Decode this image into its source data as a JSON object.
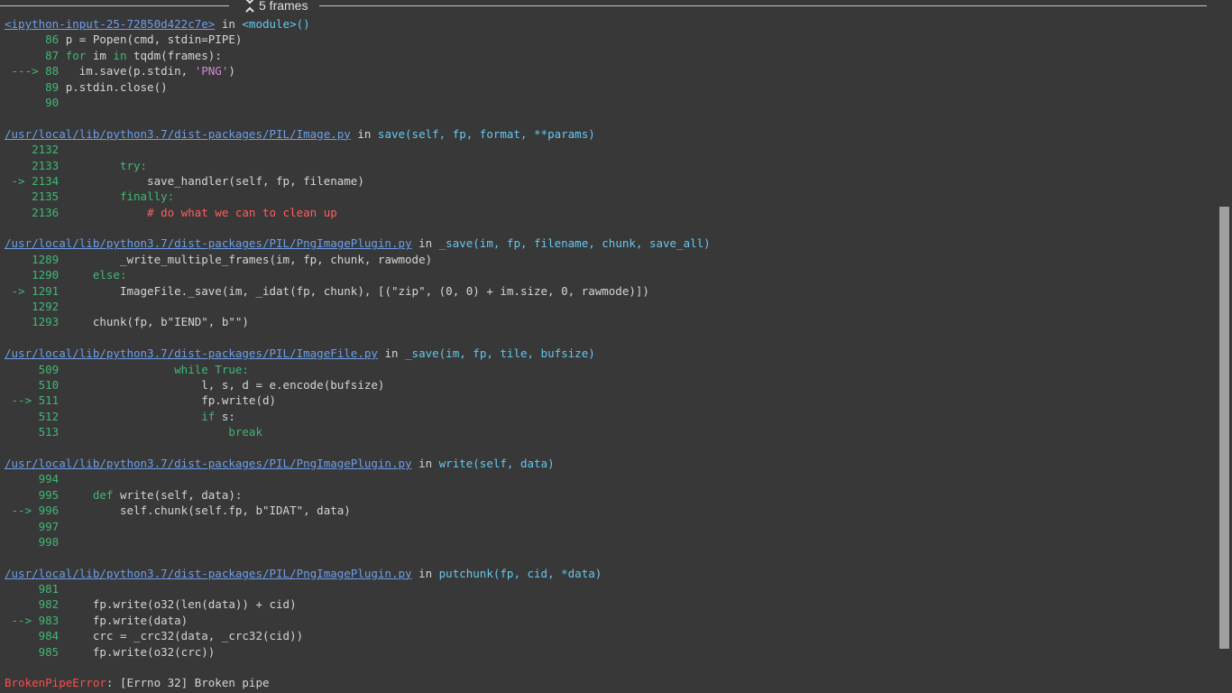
{
  "collapsed_frames": {
    "label": "5 frames"
  },
  "frames": [
    {
      "file": "<ipython-input-25-72850d422c7e>",
      "in_word": "in",
      "signature": "<module>()",
      "lines": [
        {
          "marker": "",
          "num": "86",
          "code": [
            {
              "t": "p = Popen(cmd, stdin=PIPE)",
              "c": "plain"
            }
          ]
        },
        {
          "marker": "",
          "num": "87",
          "code": [
            {
              "t": "for",
              "c": "kw"
            },
            {
              "t": " im ",
              "c": "plain"
            },
            {
              "t": "in",
              "c": "kw"
            },
            {
              "t": " tqdm(frames):",
              "c": "plain"
            }
          ]
        },
        {
          "marker": "--->",
          "num": "88",
          "code": [
            {
              "t": "  im.save(p.stdin, ",
              "c": "plain"
            },
            {
              "t": "'PNG'",
              "c": "str"
            },
            {
              "t": ")",
              "c": "plain"
            }
          ]
        },
        {
          "marker": "",
          "num": "89",
          "code": [
            {
              "t": "p.stdin.close()",
              "c": "plain"
            }
          ]
        },
        {
          "marker": "",
          "num": "90",
          "code": []
        }
      ]
    },
    {
      "file": "/usr/local/lib/python3.7/dist-packages/PIL/Image.py",
      "in_word": "in",
      "signature": "save(self, fp, format, **params)",
      "lines": [
        {
          "marker": "",
          "num": "2132",
          "code": []
        },
        {
          "marker": "",
          "num": "2133",
          "code": [
            {
              "t": "        try:",
              "c": "kw"
            }
          ]
        },
        {
          "marker": "->",
          "num": "2134",
          "code": [
            {
              "t": "            save_handler(self, fp, filename)",
              "c": "plain"
            }
          ]
        },
        {
          "marker": "",
          "num": "2135",
          "code": [
            {
              "t": "        finally:",
              "c": "kw"
            }
          ]
        },
        {
          "marker": "",
          "num": "2136",
          "code": [
            {
              "t": "            # do what we can to clean up",
              "c": "comment"
            }
          ]
        }
      ]
    },
    {
      "file": "/usr/local/lib/python3.7/dist-packages/PIL/PngImagePlugin.py",
      "in_word": "in",
      "signature": "_save(im, fp, filename, chunk, save_all)",
      "lines": [
        {
          "marker": "",
          "num": "1289",
          "code": [
            {
              "t": "        _write_multiple_frames(im, fp, chunk, rawmode)",
              "c": "plain"
            }
          ]
        },
        {
          "marker": "",
          "num": "1290",
          "code": [
            {
              "t": "    else:",
              "c": "kw"
            }
          ]
        },
        {
          "marker": "->",
          "num": "1291",
          "code": [
            {
              "t": "        ImageFile._save(im, _idat(fp, chunk), [(\"zip\", (0, 0) + im.size, 0, rawmode)])",
              "c": "plain"
            }
          ]
        },
        {
          "marker": "",
          "num": "1292",
          "code": []
        },
        {
          "marker": "",
          "num": "1293",
          "code": [
            {
              "t": "    chunk(fp, b\"IEND\", b\"\")",
              "c": "plain"
            }
          ]
        }
      ]
    },
    {
      "file": "/usr/local/lib/python3.7/dist-packages/PIL/ImageFile.py",
      "in_word": "in",
      "signature": "_save(im, fp, tile, bufsize)",
      "lines": [
        {
          "marker": "",
          "num": "509",
          "code": [
            {
              "t": "                while True:",
              "c": "kw"
            }
          ]
        },
        {
          "marker": "",
          "num": "510",
          "code": [
            {
              "t": "                    l, s, d = e.encode(bufsize)",
              "c": "plain"
            }
          ]
        },
        {
          "marker": "-->",
          "num": "511",
          "code": [
            {
              "t": "                    fp.write(d)",
              "c": "plain"
            }
          ]
        },
        {
          "marker": "",
          "num": "512",
          "code": [
            {
              "t": "                    if",
              "c": "kw"
            },
            {
              "t": " s:",
              "c": "plain"
            }
          ]
        },
        {
          "marker": "",
          "num": "513",
          "code": [
            {
              "t": "                        break",
              "c": "kw"
            }
          ]
        }
      ]
    },
    {
      "file": "/usr/local/lib/python3.7/dist-packages/PIL/PngImagePlugin.py",
      "in_word": "in",
      "signature": "write(self, data)",
      "lines": [
        {
          "marker": "",
          "num": "994",
          "code": []
        },
        {
          "marker": "",
          "num": "995",
          "code": [
            {
              "t": "    def",
              "c": "kw"
            },
            {
              "t": " write(self, data):",
              "c": "plain"
            }
          ]
        },
        {
          "marker": "-->",
          "num": "996",
          "code": [
            {
              "t": "        self.chunk(self.fp, b\"IDAT\", data)",
              "c": "plain"
            }
          ]
        },
        {
          "marker": "",
          "num": "997",
          "code": []
        },
        {
          "marker": "",
          "num": "998",
          "code": []
        }
      ]
    },
    {
      "file": "/usr/local/lib/python3.7/dist-packages/PIL/PngImagePlugin.py",
      "in_word": "in",
      "signature": "putchunk(fp, cid, *data)",
      "lines": [
        {
          "marker": "",
          "num": "981",
          "code": []
        },
        {
          "marker": "",
          "num": "982",
          "code": [
            {
              "t": "    fp.write(o32(len(data)) + cid)",
              "c": "plain"
            }
          ]
        },
        {
          "marker": "-->",
          "num": "983",
          "code": [
            {
              "t": "    fp.write(data)",
              "c": "plain"
            }
          ]
        },
        {
          "marker": "",
          "num": "984",
          "code": [
            {
              "t": "    crc = _crc32(data, _crc32(cid))",
              "c": "plain"
            }
          ]
        },
        {
          "marker": "",
          "num": "985",
          "code": [
            {
              "t": "    fp.write(o32(crc))",
              "c": "plain"
            }
          ]
        }
      ]
    }
  ],
  "error": {
    "name": "BrokenPipeError",
    "message": ": [Errno 32] Broken pipe"
  },
  "colors": {
    "background": "#383838",
    "link": "#6d9ee8",
    "keyword": "#3fb874",
    "string": "#cf8bd7",
    "comment": "#ff5f5f",
    "error": "#ff4d4d"
  }
}
